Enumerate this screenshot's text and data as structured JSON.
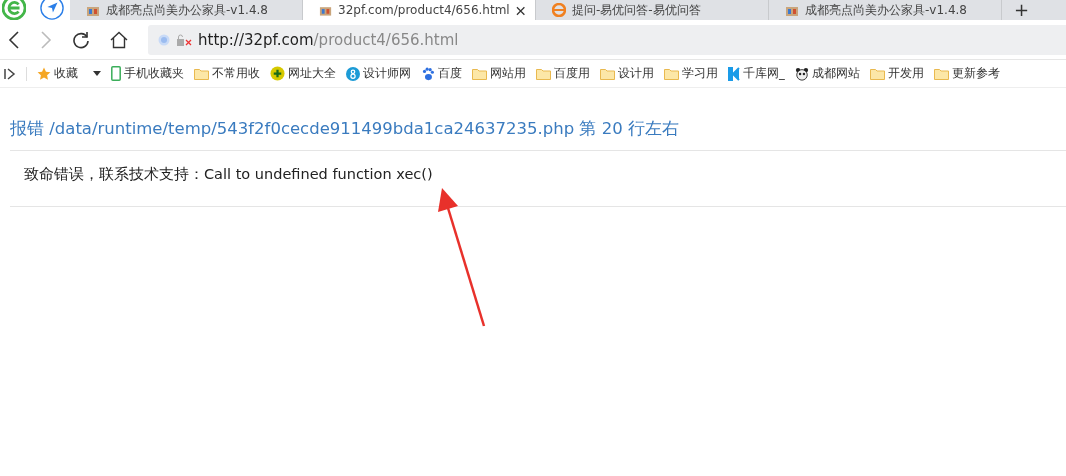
{
  "tabs": [
    {
      "title": "成都亮点尚美办公家具-v1.4.8",
      "kind": "site",
      "selected": false
    },
    {
      "title": "32pf.com/product4/656.html",
      "kind": "site",
      "selected": true
    },
    {
      "title": "提问-易优问答-易优问答",
      "kind": "e",
      "selected": false
    },
    {
      "title": "成都亮点尚美办公家具-v1.4.8",
      "kind": "site",
      "selected": false
    }
  ],
  "new_tab": "+",
  "address": {
    "host": "http://32pf.com",
    "path": "/product4/656.html"
  },
  "bookmarks": [
    {
      "label": "收藏",
      "kind": "star"
    },
    {
      "label": "手机收藏夹",
      "kind": "phone"
    },
    {
      "label": "不常用收",
      "kind": "folder"
    },
    {
      "label": "网址大全",
      "kind": "plus"
    },
    {
      "label": "设计师网",
      "kind": "eight"
    },
    {
      "label": "百度",
      "kind": "paw"
    },
    {
      "label": "网站用",
      "kind": "folder"
    },
    {
      "label": "百度用",
      "kind": "folder"
    },
    {
      "label": "设计用",
      "kind": "folder"
    },
    {
      "label": "学习用",
      "kind": "folder"
    },
    {
      "label": "千库网_",
      "kind": "k"
    },
    {
      "label": "成都网站",
      "kind": "panda"
    },
    {
      "label": "开发用",
      "kind": "folder"
    },
    {
      "label": "更新参考",
      "kind": "folder"
    }
  ],
  "error": {
    "title": "报错 /data/runtime/temp/543f2f0cecde911499bda1ca24637235.php 第 20 行左右",
    "message": "致命错误，联系技术支持：Call to undefined function xec()"
  }
}
